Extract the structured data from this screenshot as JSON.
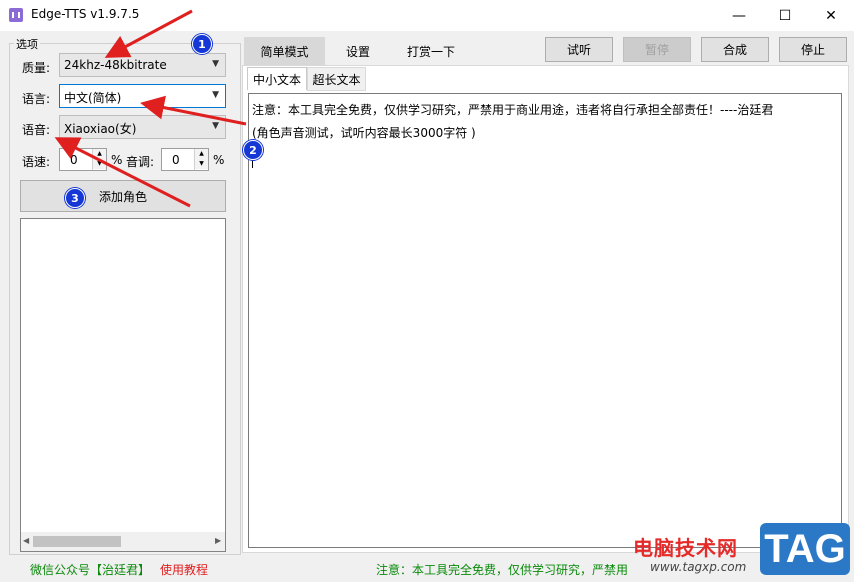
{
  "window": {
    "title": "Edge-TTS v1.9.7.5",
    "min_glyph": "—",
    "max_glyph": "☐",
    "close_glyph": "✕"
  },
  "options": {
    "group_title": "选项",
    "quality_label": "质量:",
    "quality_value": "24khz-48kbitrate",
    "language_label": "语言:",
    "language_value": "中文(简体)",
    "voice_label": "语音:",
    "voice_value": "Xiaoxiao(女)",
    "speed_label": "语速:",
    "speed_value": "0",
    "speed_unit": "%",
    "pitch_label": "音调:",
    "pitch_value": "0",
    "pitch_unit": "%",
    "add_role_label": "添加角色"
  },
  "top_tabs": [
    "简单模式",
    "设置",
    "打赏一下"
  ],
  "toolbar": {
    "listen": "试听",
    "pause": "暂停",
    "synthesize": "合成",
    "stop": "停止"
  },
  "sub_tabs": [
    "中小文本",
    "超长文本"
  ],
  "editor": {
    "line1": "注意：本工具完全免费，仅供学习研究，严禁用于商业用途，违者将自行承担全部责任！----治廷君",
    "line2": "(角色声音测试，试听内容最长3000字符 )"
  },
  "status": {
    "wechat": "微信公众号【治廷君】",
    "tutorial": "使用教程",
    "notice": "注意：本工具完全免费，仅供学习研究，严禁用"
  },
  "annotations": [
    "1",
    "2",
    "3"
  ],
  "watermark": {
    "site_name": "电脑技术网",
    "url": "www.tagxp.com",
    "tag": "TAG"
  },
  "colors": {
    "accent_focus": "#0078d7",
    "arrow": "#e01f1f",
    "badge": "#1437d6",
    "status_green": "#0a8a0a",
    "status_red": "#e11e1e"
  }
}
